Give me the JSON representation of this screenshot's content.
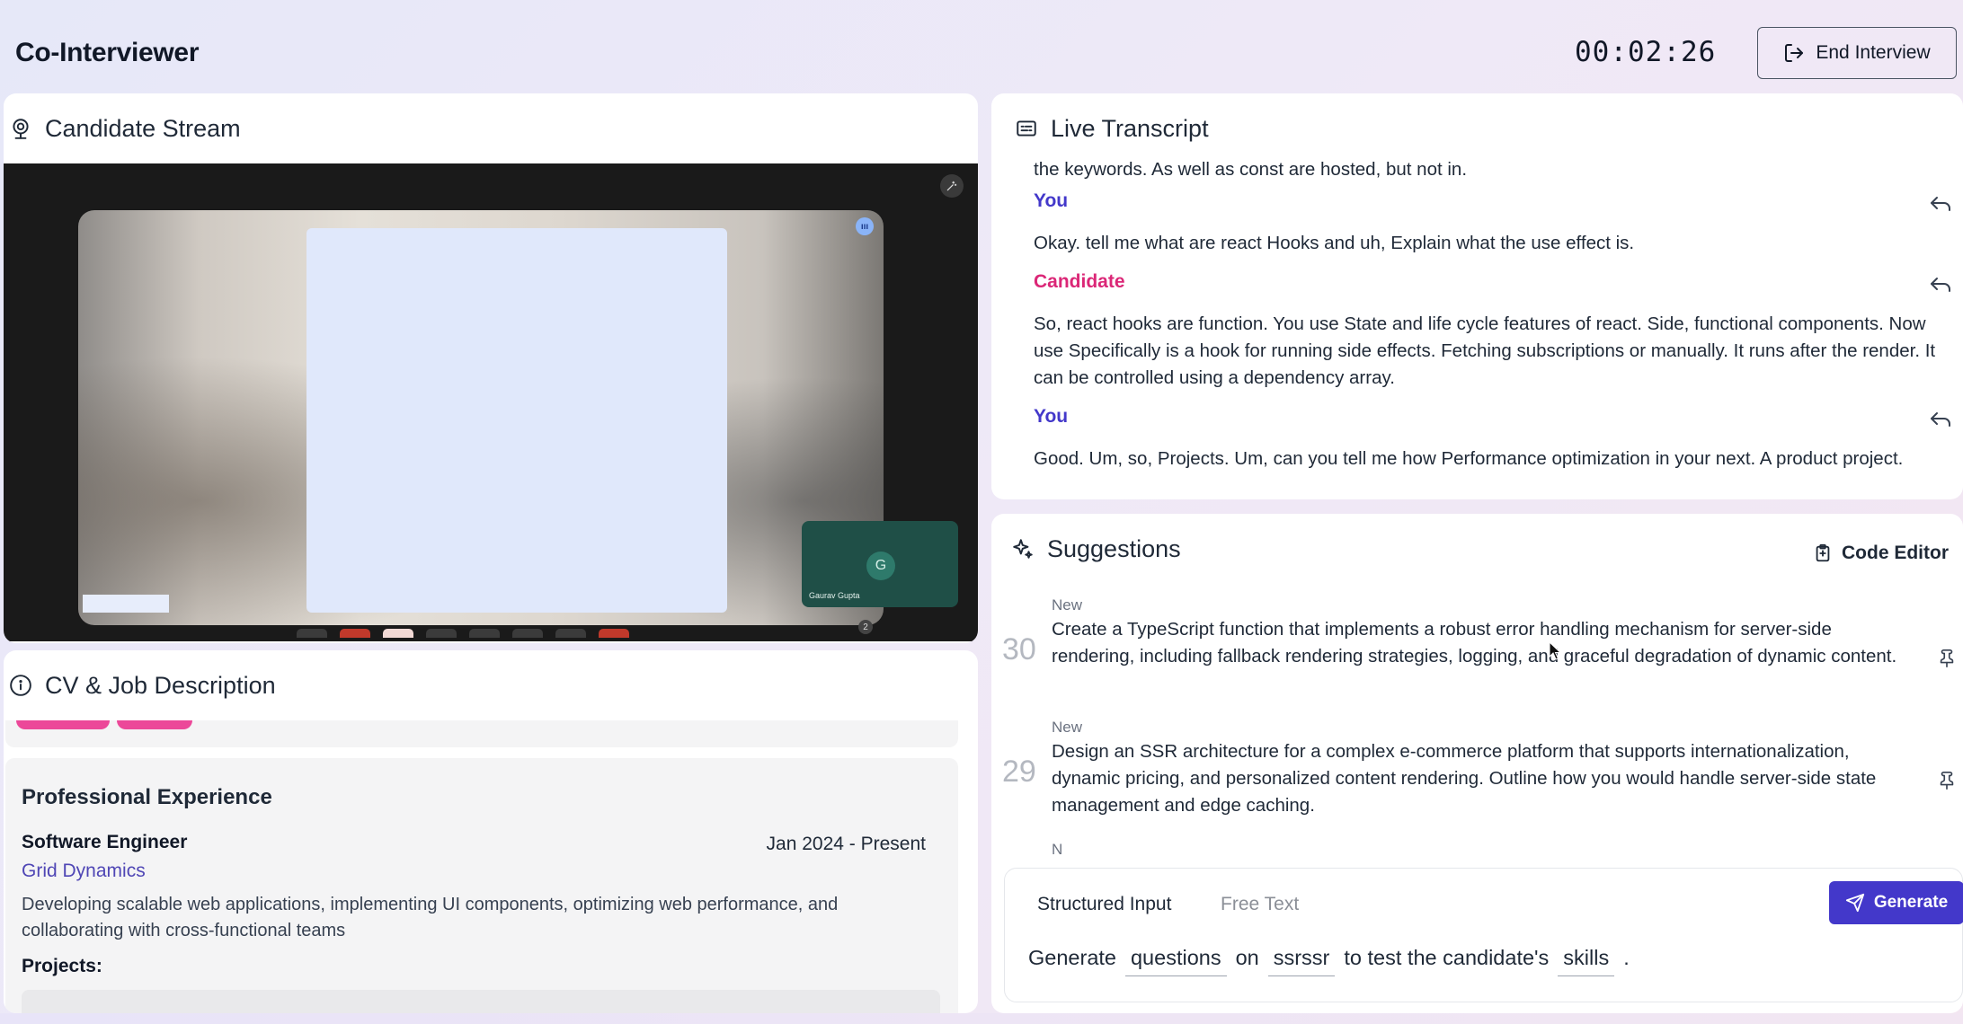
{
  "header": {
    "app_title": "Co-Interviewer",
    "timer": "00:02:26",
    "end_button_label": "End Interview"
  },
  "stream": {
    "title": "Candidate Stream",
    "self_view_initial": "G",
    "self_view_name": "Gaurav Gupta",
    "participant_count": "2"
  },
  "cv": {
    "title": "CV & Job Description",
    "section_title": "Professional Experience",
    "job": {
      "title": "Software Engineer",
      "dates": "Jan 2024 - Present",
      "company": "Grid Dynamics",
      "description": "Developing scalable web applications, implementing UI components, optimizing web performance, and collaborating with cross-functional teams"
    },
    "projects_label": "Projects:"
  },
  "transcript": {
    "title": "Live Transcript",
    "entries": [
      {
        "speaker": "",
        "text": "the keywords. As well as const are hosted, but not in."
      },
      {
        "speaker": "You",
        "text": "Okay. tell me what are react Hooks and uh, Explain what the use effect is."
      },
      {
        "speaker": "Candidate",
        "text": "So, react hooks are function. You use State and life cycle features of react. Side, functional components. Now use Specifically is a hook for running side effects. Fetching subscriptions or manually. It runs after the render. It can be controlled using a dependency array."
      },
      {
        "speaker": "You",
        "text": "Good. Um, so, Projects. Um, can you tell me how Performance optimization in your next. A product project."
      }
    ]
  },
  "suggestions": {
    "title": "Suggestions",
    "code_editor_label": "Code Editor",
    "items": [
      {
        "number": "30",
        "status": "New",
        "text": "Create a TypeScript function that implements a robust error handling mechanism for server-side rendering, including fallback rendering strategies, logging, and graceful degradation of dynamic content."
      },
      {
        "number": "29",
        "status": "New",
        "text": "Design an SSR architecture for a complex e-commerce platform that supports internationalization, dynamic pricing, and personalized content rendering. Outline how you would handle server-side state management and edge caching."
      }
    ],
    "next_status_partial": "N"
  },
  "input": {
    "tab_structured": "Structured Input",
    "tab_free": "Free Text",
    "generate_label": "Generate",
    "sentence": {
      "w1": "Generate",
      "slot1": "questions",
      "w2": "on",
      "slot2": "ssrssr",
      "w3": "to test the candidate's",
      "slot3": "skills",
      "end": "."
    }
  },
  "colors": {
    "accent": "#4338ca",
    "candidate": "#db2777",
    "you": "#4338ca"
  }
}
